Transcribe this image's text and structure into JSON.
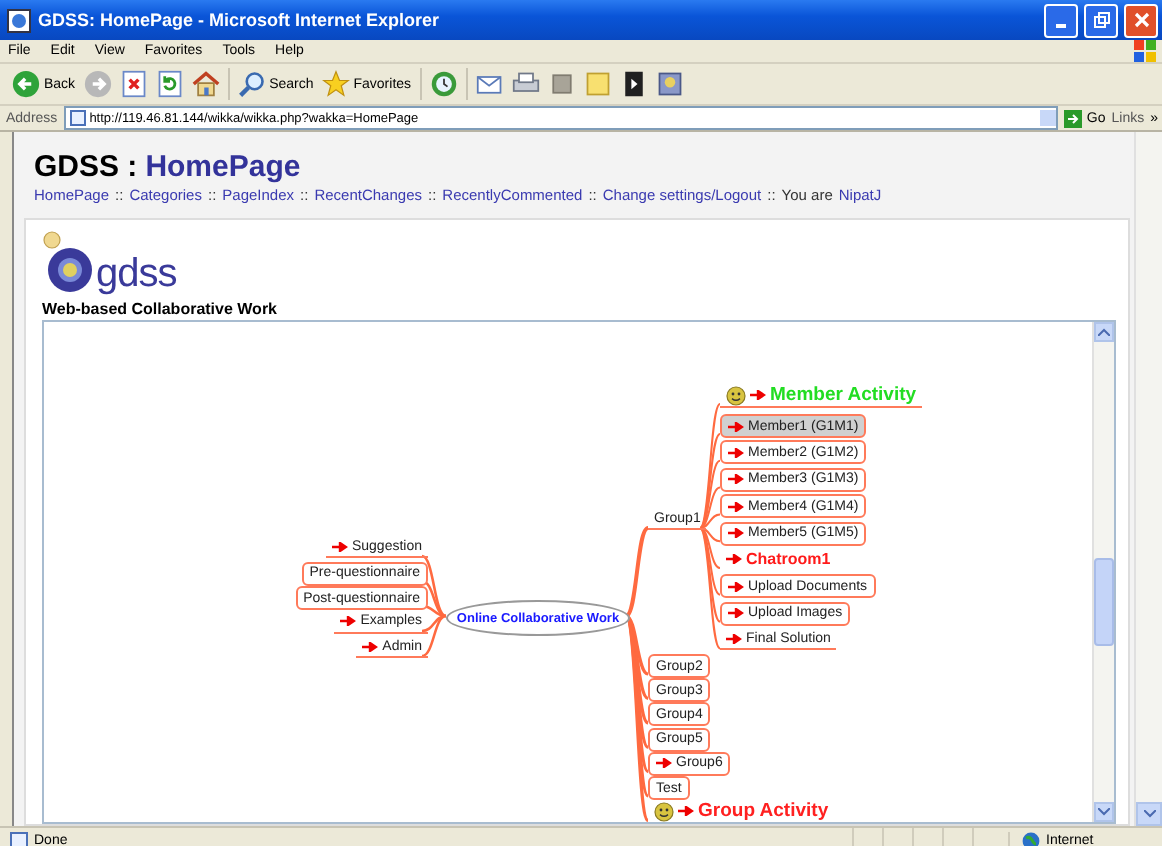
{
  "window": {
    "title": "GDSS: HomePage - Microsoft Internet Explorer"
  },
  "menu": [
    "File",
    "Edit",
    "View",
    "Favorites",
    "Tools",
    "Help"
  ],
  "toolbar": [
    {
      "kind": "back",
      "label": "Back"
    },
    {
      "kind": "forward"
    },
    {
      "kind": "stop"
    },
    {
      "kind": "refresh"
    },
    {
      "kind": "home"
    },
    {
      "kind": "search",
      "label": "Search"
    },
    {
      "kind": "favorites",
      "label": "Favorites"
    },
    {
      "kind": "history"
    },
    {
      "kind": "mail"
    },
    {
      "kind": "print"
    },
    {
      "kind": "edit"
    },
    {
      "kind": "note"
    },
    {
      "kind": "media"
    },
    {
      "kind": "messenger"
    }
  ],
  "address": {
    "label": "Address",
    "value": "http://119.46.81.144/wikka/wikka.php?wakka=HomePage",
    "go": "Go",
    "links": "Links",
    "more": "»"
  },
  "page": {
    "site": "GDSS :",
    "title": "HomePage",
    "nav": [
      {
        "kind": "link",
        "text": "HomePage"
      },
      {
        "kind": "sep",
        "text": "::"
      },
      {
        "kind": "link",
        "text": "Categories"
      },
      {
        "kind": "sep",
        "text": "::"
      },
      {
        "kind": "link",
        "text": "PageIndex"
      },
      {
        "kind": "sep",
        "text": "::"
      },
      {
        "kind": "link",
        "text": "RecentChanges"
      },
      {
        "kind": "sep",
        "text": "::"
      },
      {
        "kind": "link",
        "text": "RecentlyCommented"
      },
      {
        "kind": "sep",
        "text": "::"
      },
      {
        "kind": "link",
        "text": "Change settings/Logout"
      },
      {
        "kind": "sep",
        "text": "::"
      },
      {
        "kind": "text",
        "text": "You are"
      },
      {
        "kind": "link",
        "text": "NipatJ"
      }
    ],
    "logo": "gdss",
    "subtitle": "Web-based Collaborative Work"
  },
  "mindmap": {
    "center": "Online Collaborative Work",
    "left": [
      {
        "label": "Suggestion",
        "kind": "text",
        "arrow": true
      },
      {
        "label": "Pre-questionnaire",
        "kind": "box",
        "arrow": false
      },
      {
        "label": "Post-questionnaire",
        "kind": "box",
        "arrow": false
      },
      {
        "label": "Examples",
        "kind": "text",
        "arrow": true
      },
      {
        "label": "Admin",
        "kind": "text",
        "arrow": true
      }
    ],
    "right": [
      {
        "label": "Group1",
        "kind": "text",
        "arrow": false,
        "children": [
          {
            "label": "Member Activity",
            "kind": "header",
            "arrow": true,
            "selected": false,
            "color": "#22dd22"
          },
          {
            "label": "Member1 (G1M1)",
            "kind": "box",
            "arrow": true,
            "selected": true
          },
          {
            "label": "Member2 (G1M2)",
            "kind": "box",
            "arrow": true,
            "selected": false
          },
          {
            "label": "Member3 (G1M3)",
            "kind": "box",
            "arrow": true,
            "selected": false
          },
          {
            "label": "Member4 (G1M4)",
            "kind": "box",
            "arrow": true,
            "selected": false
          },
          {
            "label": "Member5 (G1M5)",
            "kind": "box",
            "arrow": true,
            "selected": false
          },
          {
            "label": "Chatroom1",
            "kind": "strong",
            "arrow": true,
            "selected": false
          },
          {
            "label": "Upload Documents",
            "kind": "box",
            "arrow": true,
            "selected": false
          },
          {
            "label": "Upload Images",
            "kind": "box",
            "arrow": true,
            "selected": false
          },
          {
            "label": "Final Solution",
            "kind": "text",
            "arrow": true,
            "selected": false
          }
        ]
      },
      {
        "label": "Group2",
        "kind": "box",
        "arrow": false
      },
      {
        "label": "Group3",
        "kind": "box",
        "arrow": false
      },
      {
        "label": "Group4",
        "kind": "box",
        "arrow": false
      },
      {
        "label": "Group5",
        "kind": "box",
        "arrow": false
      },
      {
        "label": "Group6",
        "kind": "box",
        "arrow": true
      },
      {
        "label": "Test",
        "kind": "box",
        "arrow": false
      },
      {
        "label": "Group Activity",
        "kind": "header",
        "arrow": true,
        "color": "#ff2020"
      }
    ]
  },
  "status": {
    "text": "Done",
    "zone": "Internet"
  }
}
